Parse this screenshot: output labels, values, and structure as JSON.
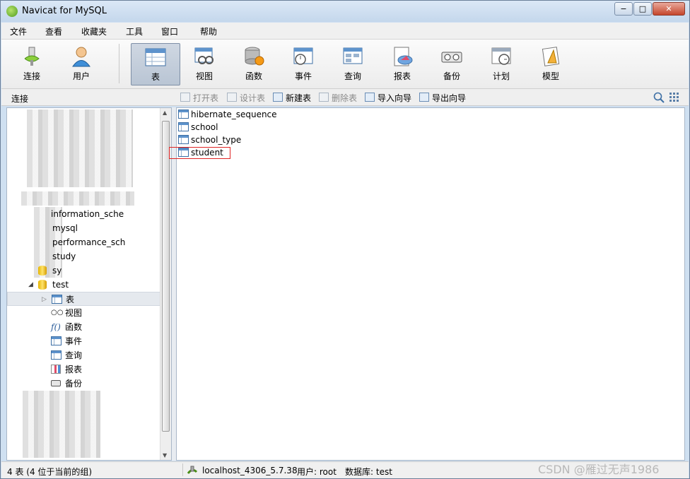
{
  "window": {
    "title": "Navicat for MySQL",
    "min": "−",
    "max": "□",
    "close": "✕"
  },
  "menu": [
    "文件",
    "查看",
    "收藏夹",
    "工具",
    "窗口",
    "帮助"
  ],
  "toolbar": {
    "connect": "连接",
    "user": "用户",
    "table": "表",
    "view": "视图",
    "function": "函数",
    "event": "事件",
    "query": "查询",
    "report": "报表",
    "backup": "备份",
    "schedule": "计划",
    "model": "模型"
  },
  "subbar": {
    "section": "连接",
    "open_table": "打开表",
    "design_table": "设计表",
    "new_table": "新建表",
    "delete_table": "删除表",
    "import_wizard": "导入向导",
    "export_wizard": "导出向导"
  },
  "tree": {
    "dbs": [
      "information_sche",
      "mysql",
      "performance_sch",
      "study",
      "sy"
    ],
    "test_db": "test",
    "children": [
      "表",
      "视图",
      "函数",
      "事件",
      "查询",
      "报表",
      "备份"
    ]
  },
  "tables": [
    "hibernate_sequence",
    "school",
    "school_type",
    "student"
  ],
  "status": {
    "count": "4 表 (4 位于当前的组)",
    "connection": "localhost_4306_5.7.38",
    "user": "用户: root",
    "database": "数据库: test"
  },
  "watermark": "CSDN @雁过无声1986",
  "colors": {
    "highlight": "#e02424",
    "selected_tool": "#b9c5d4"
  }
}
